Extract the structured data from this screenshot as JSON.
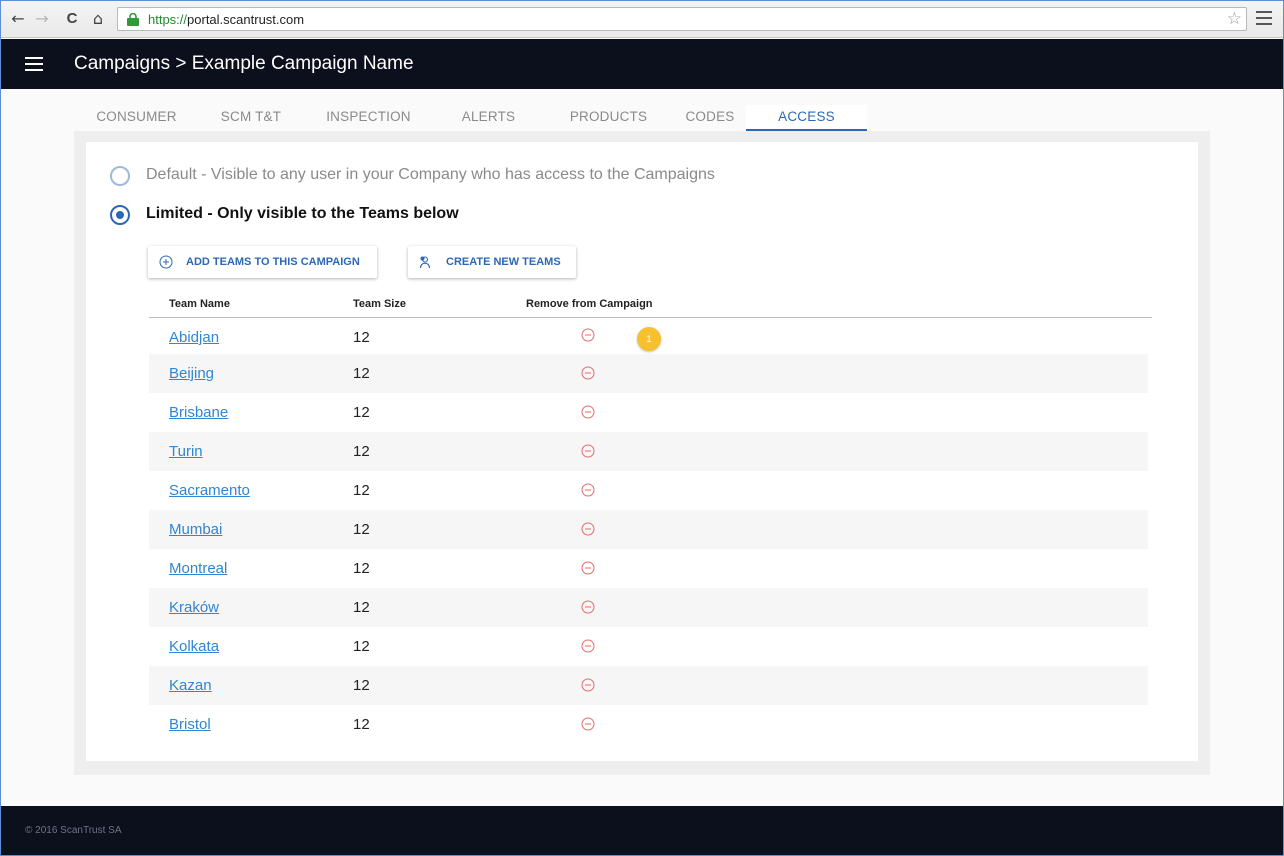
{
  "browser": {
    "url_scheme": "https://",
    "url_host": "portal.scantrust.com",
    "back_icon": "←",
    "forward_icon": "→",
    "reload_icon": "C",
    "home_icon": "⌂",
    "star_icon": "☆"
  },
  "header": {
    "title": "Campaigns > Example Campaign Name",
    "background": "#0c0f1c"
  },
  "tabs": [
    {
      "label": "CONSUMER"
    },
    {
      "label": "SCM T&T"
    },
    {
      "label": "INSPECTION"
    },
    {
      "label": "ALERTS"
    },
    {
      "label": "PRODUCTS"
    },
    {
      "label": "CODES"
    },
    {
      "label": "ACCESS",
      "active": true
    }
  ],
  "visibility": {
    "default_label": "Default - Visible to any user in your Company who has access to the Campaigns",
    "limited_label": "Limited - Only visible to the Teams below",
    "selected": "limited"
  },
  "actions": {
    "add_teams_label": "ADD TEAMS TO THIS CAMPAIGN",
    "create_teams_label": "CREATE NEW TEAMS"
  },
  "table": {
    "columns": [
      "Team Name",
      "Team Size",
      "Remove from Campaign"
    ],
    "rows": [
      {
        "name": "Abidjan",
        "size": "12"
      },
      {
        "name": "Beijing",
        "size": "12"
      },
      {
        "name": "Brisbane",
        "size": "12"
      },
      {
        "name": "Turin",
        "size": "12"
      },
      {
        "name": "Sacramento",
        "size": "12"
      },
      {
        "name": "Mumbai",
        "size": "12"
      },
      {
        "name": "Montreal",
        "size": "12"
      },
      {
        "name": "Kraków",
        "size": "12"
      },
      {
        "name": "Kolkata",
        "size": "12"
      },
      {
        "name": "Kazan",
        "size": "12"
      },
      {
        "name": "Bristol",
        "size": "12"
      }
    ]
  },
  "annotation_badge": "1",
  "footer": {
    "copyright": "© 2016 ScanTrust SA"
  },
  "colors": {
    "accent": "#2b68b8",
    "link": "#2f86d2",
    "remove": "#e86a6a",
    "badge": "#f6c12c"
  }
}
